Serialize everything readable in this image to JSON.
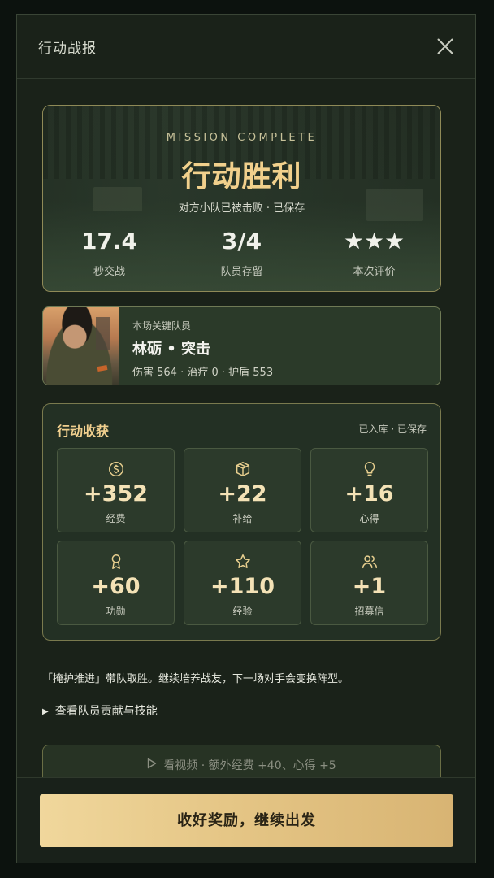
{
  "header": {
    "title": "行动战报",
    "close_icon": "close-icon"
  },
  "hero": {
    "tagline": "MISSION COMPLETE",
    "result": "行动胜利",
    "subtitle": "对方小队已被击败 · 已保存",
    "stats": [
      {
        "value": "17.4",
        "label": "秒交战"
      },
      {
        "value": "3/4",
        "label": "队员存留"
      },
      {
        "value": "★★★",
        "label": "本次评价",
        "stars": 3
      }
    ]
  },
  "key_player": {
    "caption": "本场关键队员",
    "name": "林砺 • 突击",
    "stats": "伤害 564 · 治疗 0 · 护盾 553"
  },
  "rewards": {
    "title": "行动收获",
    "status": "已入库 · 已保存",
    "items": [
      {
        "icon": "coin-icon",
        "value": "+352",
        "label": "经费"
      },
      {
        "icon": "box-icon",
        "value": "+22",
        "label": "补给"
      },
      {
        "icon": "lightbulb-icon",
        "value": "+16",
        "label": "心得"
      },
      {
        "icon": "medal-icon",
        "value": "+60",
        "label": "功勋"
      },
      {
        "icon": "star-icon",
        "value": "+110",
        "label": "经验"
      },
      {
        "icon": "users-icon",
        "value": "+1",
        "label": "招募信"
      }
    ]
  },
  "note": "「掩护推进」带队取胜。继续培养战友，下一场对手会变换阵型。",
  "expand": {
    "label": "查看队员贡献与技能"
  },
  "video": {
    "label": "看视频 · 额外经费 +40、心得 +5"
  },
  "cta": {
    "label": "收好奖励，继续出发"
  },
  "colors": {
    "accent_gold": "#f0cf8e",
    "panel_bg": "#1a2219",
    "cta_gold": "#e5c686"
  }
}
